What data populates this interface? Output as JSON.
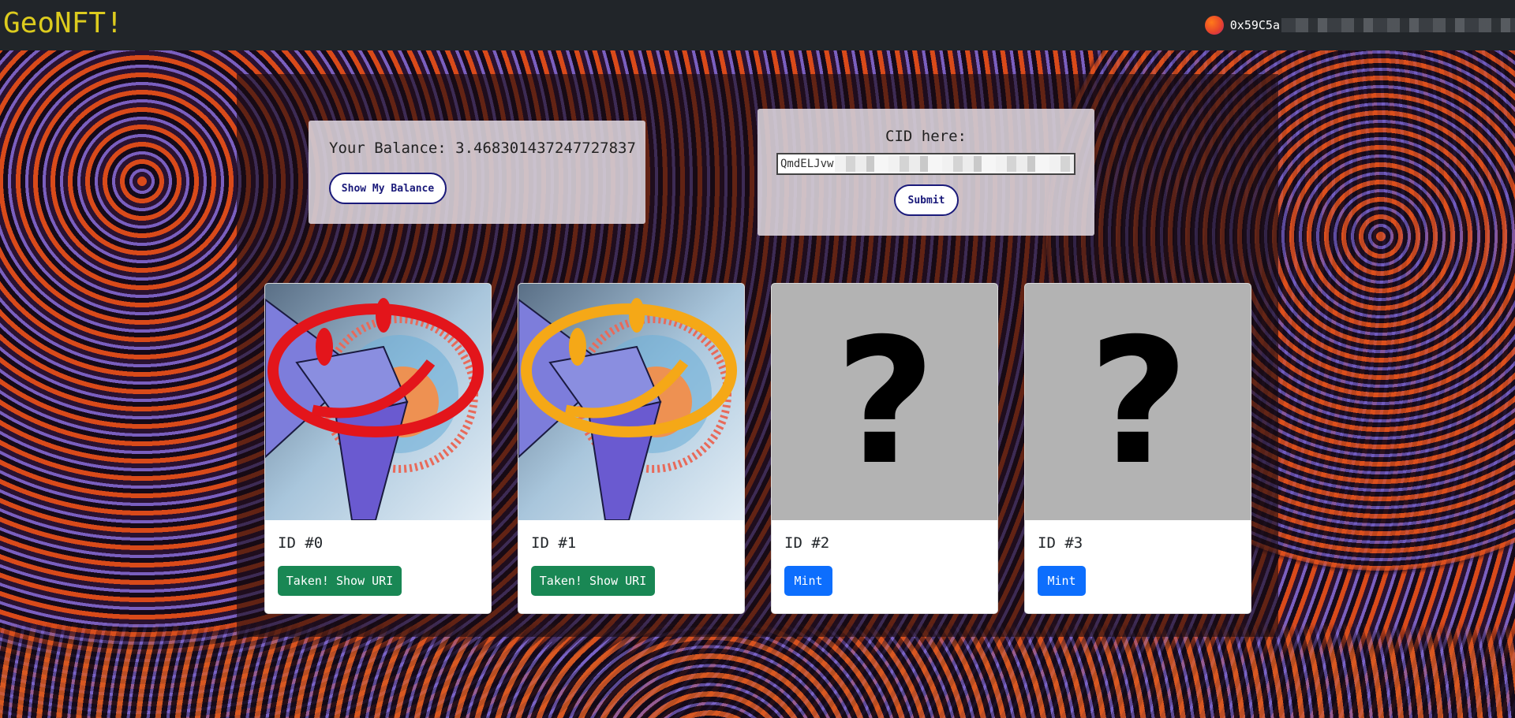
{
  "navbar": {
    "brand": "GeoNFT!",
    "account_address": "0x59C5a"
  },
  "balance_panel": {
    "balance_text": "Your Balance: 3.468301437247727837",
    "button_label": "Show My Balance"
  },
  "cid_panel": {
    "label": "CID here:",
    "input_value": "QmdELJvw",
    "submit_label": "Submit"
  },
  "cards": [
    {
      "id_label": "ID #0",
      "button_label": "Taken! Show URI",
      "status": "taken",
      "image": "red-smiley-artwork"
    },
    {
      "id_label": "ID #1",
      "button_label": "Taken! Show URI",
      "status": "taken",
      "image": "yellow-smiley-artwork"
    },
    {
      "id_label": "ID #2",
      "button_label": "Mint",
      "status": "available",
      "image": "question-mark-placeholder"
    },
    {
      "id_label": "ID #3",
      "button_label": "Mint",
      "status": "available",
      "image": "question-mark-placeholder"
    }
  ],
  "placeholder_glyph": "?",
  "colors": {
    "navbar_bg": "#212529",
    "brand": "#dccb1e",
    "taken_button": "#198754",
    "mint_button": "#0d6efd",
    "pill_border": "#1a1a7a"
  }
}
